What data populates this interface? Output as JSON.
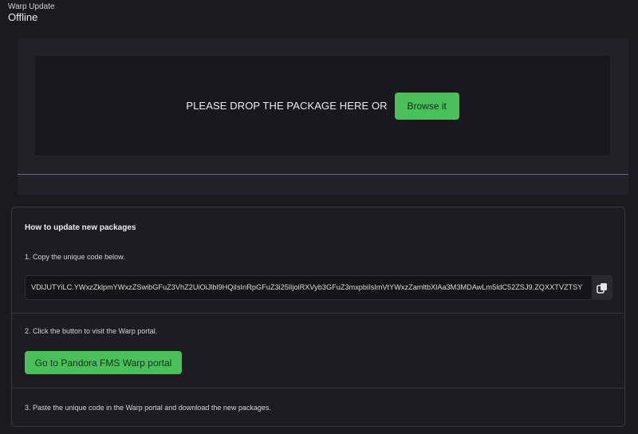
{
  "header": {
    "title": "Warp Update",
    "status": "Offline"
  },
  "drop_zone": {
    "text": "PLEASE DROP THE PACKAGE HERE OR",
    "browse_label": "Browse it"
  },
  "instructions": {
    "title": "How to update new packages",
    "step1": "1. Copy the unique code below.",
    "code": "VDlJUTYiLC.YWxzZklpmYWxzZSwibGFuZ3VhZ2UiOiJlbl9HQiIsInRpGFuZ3i25lIjoiRXVyb3GFuZ3mxpbiIsImVtYWxzZamltbXlAa3M3MDAwLm5ldC52ZSJ9.ZQXXTVZTSY",
    "copy_icon": "copy-icon",
    "step2": "2. Click the button to visit the Warp portal.",
    "portal_label": "Go to Pandora FMS Warp portal",
    "step3": "3. Paste the unique code in the Warp portal and download the new packages."
  },
  "colors": {
    "background": "#1a1a1f",
    "accent_green": "#4ac05a",
    "panel": "#222129"
  }
}
